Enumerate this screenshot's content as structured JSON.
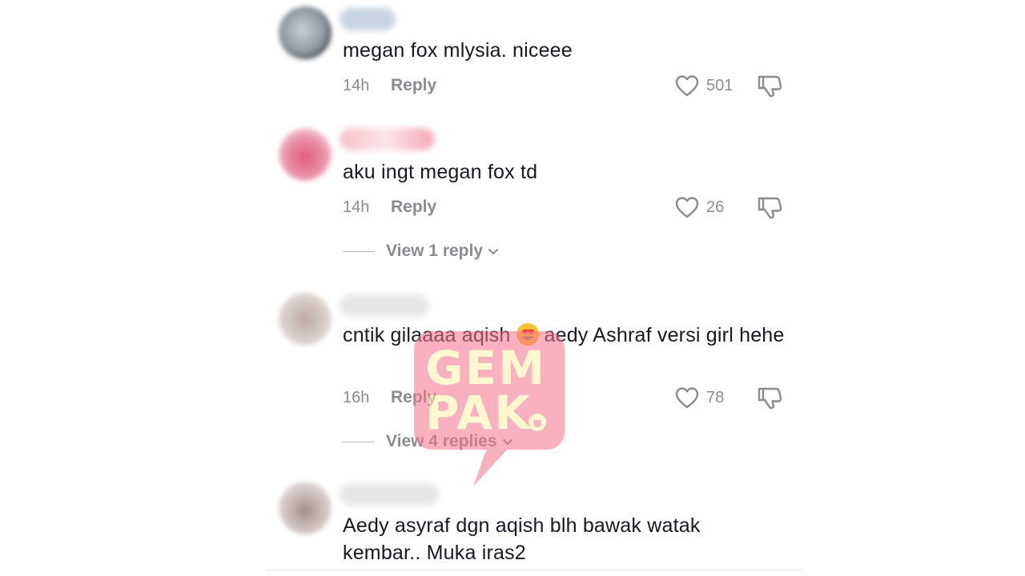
{
  "comments": [
    {
      "text": "megan fox mlysia. niceee",
      "time": "14h",
      "reply_label": "Reply",
      "likes": "501",
      "avatar_color": "#9aa3ad",
      "username_color": "#c7d3e2"
    },
    {
      "text": "aku ingt megan fox td",
      "time": "14h",
      "reply_label": "Reply",
      "likes": "26",
      "view_replies": "View 1 reply",
      "avatar_color": "#e47a97",
      "username_color": "#f6c9d2"
    },
    {
      "text_before_emoji": "cntik gilaaaa aqish",
      "emoji": "smiling-face-with-heart-eyes",
      "text_after_emoji": "aedy Ashraf versi girl hehe",
      "time": "16h",
      "reply_label": "Reply",
      "likes": "78",
      "view_replies": "View 4 replies",
      "avatar_color": "#c9bdb8",
      "username_color": "#e6e6e6"
    },
    {
      "text": "Aedy asyraf dgn aqish blh bawak watak kembar.. Muka iras2",
      "avatar_color": "#b7a8a6",
      "username_color": "#e6e6e6"
    }
  ],
  "watermark": {
    "line1": "GEM",
    "line2": "PAK",
    "color": "#f7728c",
    "text_color": "#fff2a8"
  },
  "colors": {
    "text": "#161823",
    "secondary": "#8a8b91"
  }
}
